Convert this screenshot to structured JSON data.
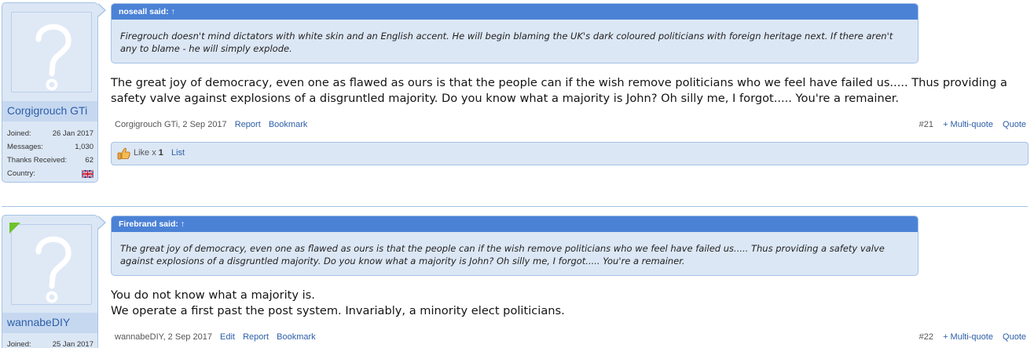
{
  "posts": [
    {
      "user": {
        "name": "Corgigrouch GTi",
        "stats": [
          {
            "label": "Joined:",
            "value": "26 Jan 2017"
          },
          {
            "label": "Messages:",
            "value": "1,030"
          },
          {
            "label": "Thanks Received:",
            "value": "62"
          },
          {
            "label": "Country:",
            "value": ""
          }
        ],
        "country_flag_icon": "uk-flag-icon"
      },
      "quote": {
        "header": "noseall said: ↑",
        "text": "Firegrouch doesn't mind dictators with white skin and an English accent. He will begin blaming the UK's dark coloured politicians with foreign heritage next. If there aren't any to blame - he will simply explode."
      },
      "message": "The great joy of democracy, even one as flawed as ours is that the people can if the wish remove politicians who we feel have failed us..... Thus providing a safety valve against explosions of a disgruntled majority. Do you know what a majority is John? Oh silly me, I forgot..... You're a remainer.",
      "meta": {
        "author_date": "Corgigrouch GTi, 2 Sep 2017",
        "report": "Report",
        "bookmark": "Bookmark",
        "number": "#21",
        "multiquote": "+ Multi-quote",
        "quote": "Quote"
      },
      "likes": {
        "label": "Like x ",
        "count": "1",
        "list": "List"
      }
    },
    {
      "user": {
        "name": "wannabeDIY",
        "online": true,
        "stats": [
          {
            "label": "Joined:",
            "value": "25 Jan 2017"
          }
        ]
      },
      "quote": {
        "header": "Firebrand said: ↑",
        "text": "The great joy of democracy, even one as flawed as ours is that the people can if the wish remove politicians who we feel have failed us..... Thus providing a safety valve against explosions of a disgruntled majority. Do you know what a majority is John? Oh silly me, I forgot..... You're a remainer."
      },
      "message_lines": [
        "You do not know what a majority is.",
        "We operate a first past the post system. Invariably, a minority elect politicians."
      ],
      "meta": {
        "author_date": "wannabeDIY, 2 Sep 2017",
        "edit": "Edit",
        "report": "Report",
        "bookmark": "Bookmark",
        "number": "#22",
        "multiquote": "+ Multi-quote",
        "quote": "Quote"
      }
    }
  ],
  "colors": {
    "quote_header": "#4b82d6",
    "panel_bg": "#dce7f5",
    "border": "#a5c3e6",
    "link": "#2d5ea8",
    "online": "#6ec32c"
  }
}
